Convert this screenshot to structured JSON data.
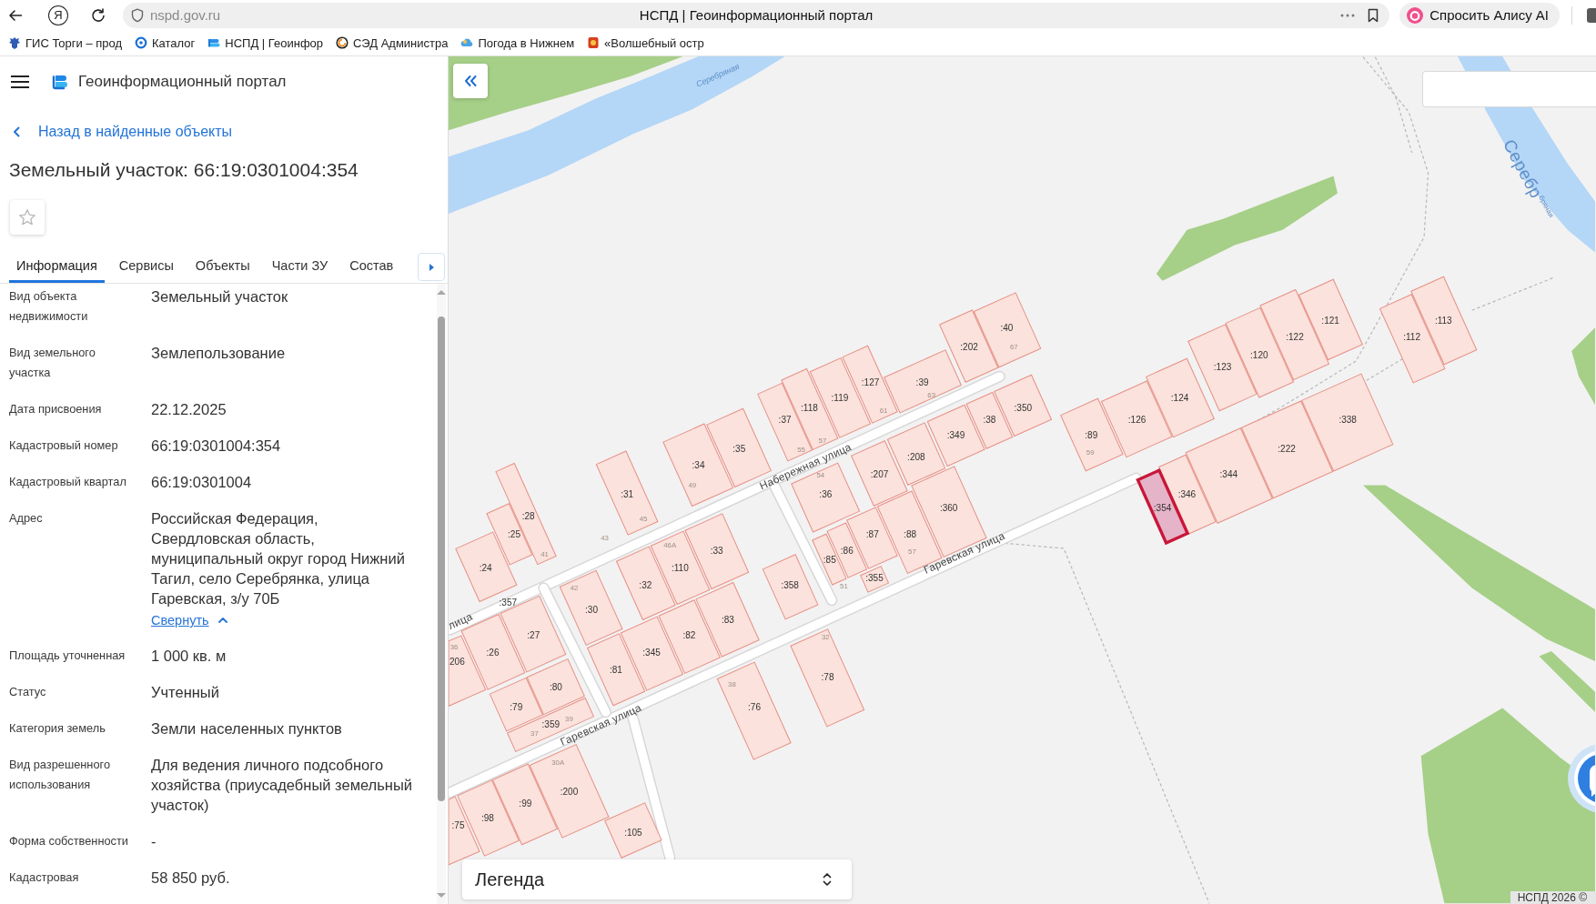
{
  "browser": {
    "home_logo": "Я",
    "address": "nspd.gov.ru",
    "tab_title": "НСПД | Геоинформационный портал",
    "assistant_button": "Спросить Алису AI",
    "bookmarks": [
      {
        "label": "ГИС Торги – прод"
      },
      {
        "label": "Каталог"
      },
      {
        "label": "НСПД | Геоинфор"
      },
      {
        "label": "СЭД Администра"
      },
      {
        "label": "Погода в Нижнем"
      },
      {
        "label": "«Волшебный остр"
      }
    ]
  },
  "sidebar": {
    "app_title": "Геоинформационный портал",
    "back_link": "Назад в найденные объекты",
    "heading": "Земельный участок: 66:19:0301004:354",
    "favorited": false,
    "tabs": [
      {
        "label": "Информация",
        "selected": true
      },
      {
        "label": "Сервисы",
        "selected": false
      },
      {
        "label": "Объекты",
        "selected": false
      },
      {
        "label": "Части ЗУ",
        "selected": false
      },
      {
        "label": "Состав",
        "selected": false
      }
    ],
    "fields": [
      {
        "label": "Вид объекта недвижимости",
        "value": "Земельный участок"
      },
      {
        "label": "Вид земельного участка",
        "value": "Землепользование"
      },
      {
        "label": "Дата присвоения",
        "value": "22.12.2025"
      },
      {
        "label": "Кадастровый номер",
        "value": "66:19:0301004:354"
      },
      {
        "label": "Кадастровый квартал",
        "value": "66:19:0301004"
      },
      {
        "label": "Адрес",
        "value": "Российская Федерация, Свердловская область, муниципальный округ город Нижний Тагил, село Серебрянка, улица Гаревская, з/у 70Б",
        "toggle": "Свернуть"
      },
      {
        "label": "Площадь уточненная",
        "value": "1 000 кв. м"
      },
      {
        "label": "Статус",
        "value": "Учтенный"
      },
      {
        "label": "Категория земель",
        "value": "Земли населенных пунктов"
      },
      {
        "label": "Вид разрешенного использования",
        "value": "Для ведения личного подсобного хозяйства (приусадебный земельный участок)"
      },
      {
        "label": "Форма собственности",
        "value": "-"
      },
      {
        "label": "Кадастровая",
        "value": "58 850 руб."
      }
    ]
  },
  "map": {
    "river_labels": [
      {
        "text": "Серебряная"
      },
      {
        "text": "Серебр"
      },
      {
        "text": "бряная"
      }
    ],
    "street_labels": [
      {
        "text": "Набережная улица"
      },
      {
        "text": "Гаревская улица"
      },
      {
        "text": "лица"
      },
      {
        "text": "Гаревская улица"
      }
    ],
    "parcels": [
      {
        "label": ":121",
        "selected": false
      },
      {
        "label": ":113",
        "selected": false
      },
      {
        "label": ":40",
        "selected": false
      },
      {
        "label": ":122",
        "selected": false
      },
      {
        "label": ":112",
        "selected": false
      },
      {
        "label": ":202",
        "selected": false
      },
      {
        "label": ":120",
        "selected": false
      },
      {
        "label": ":123",
        "selected": false
      },
      {
        "label": ":127",
        "selected": false
      },
      {
        "label": ":39",
        "selected": false
      },
      {
        "label": ":119",
        "selected": false
      },
      {
        "label": ":124",
        "selected": false
      },
      {
        "label": ":118",
        "selected": false
      },
      {
        "label": ":350",
        "selected": false
      },
      {
        "label": ":37",
        "selected": false
      },
      {
        "label": ":38",
        "selected": false
      },
      {
        "label": ":126",
        "selected": false
      },
      {
        "label": ":338",
        "selected": false
      },
      {
        "label": ":349",
        "selected": false
      },
      {
        "label": ":89",
        "selected": false
      },
      {
        "label": ":35",
        "selected": false
      },
      {
        "label": ":222",
        "selected": false
      },
      {
        "label": ":208",
        "selected": false
      },
      {
        "label": ":34",
        "selected": false
      },
      {
        "label": ":207",
        "selected": false
      },
      {
        "label": ":344",
        "selected": false
      },
      {
        "label": ":31",
        "selected": false
      },
      {
        "label": ":36",
        "selected": false
      },
      {
        "label": ":346",
        "selected": false
      },
      {
        "label": ":360",
        "selected": false
      },
      {
        "label": ":354",
        "selected": true
      },
      {
        "label": ":28",
        "selected": false
      },
      {
        "label": ":25",
        "selected": false
      },
      {
        "label": ":87",
        "selected": false
      },
      {
        "label": ":88",
        "selected": false
      },
      {
        "label": ":33",
        "selected": false
      },
      {
        "label": ":86",
        "selected": false
      },
      {
        "label": ":85",
        "selected": false
      },
      {
        "label": ":24",
        "selected": false
      },
      {
        "label": ":110",
        "selected": false
      },
      {
        "label": ":355",
        "selected": false
      },
      {
        "label": ":32",
        "selected": false
      },
      {
        "label": ":358",
        "selected": false
      },
      {
        "label": ":357",
        "selected": false
      },
      {
        "label": ":30",
        "selected": false
      },
      {
        "label": ":83",
        "selected": false
      },
      {
        "label": ":27",
        "selected": false
      },
      {
        "label": ":82",
        "selected": false
      },
      {
        "label": ":26",
        "selected": false
      },
      {
        "label": ":345",
        "selected": false
      },
      {
        "label": "206",
        "selected": false
      },
      {
        "label": ":81",
        "selected": false
      },
      {
        "label": ":78",
        "selected": false
      },
      {
        "label": ":80",
        "selected": false
      },
      {
        "label": ":79",
        "selected": false
      },
      {
        "label": ":76",
        "selected": false
      },
      {
        "label": ":359",
        "selected": false
      },
      {
        "label": ":200",
        "selected": false
      },
      {
        "label": ":99",
        "selected": false
      },
      {
        "label": ":98",
        "selected": false
      },
      {
        "label": ":75",
        "selected": false
      },
      {
        "label": ":105",
        "selected": false
      }
    ],
    "house_numbers": [
      "67",
      "63",
      "61",
      "57",
      "55",
      "59",
      "54",
      "49",
      "45",
      "43",
      "46А",
      "41",
      "57",
      "42",
      "51",
      "32",
      "36",
      "38",
      "39",
      "37",
      "30А"
    ],
    "legend": "Легенда",
    "attribution": "НСПД 2026 ©"
  }
}
